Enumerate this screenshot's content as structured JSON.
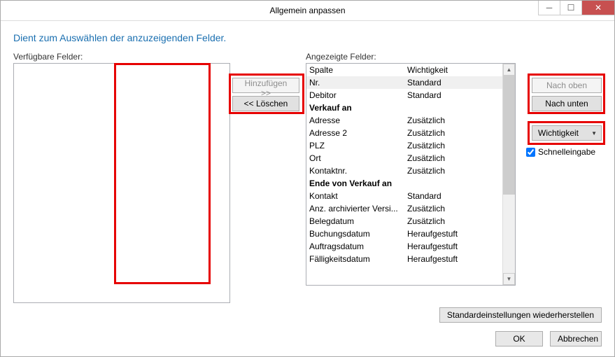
{
  "window": {
    "title": "Allgemein anpassen"
  },
  "description": "Dient zum Auswählen der anzuzeigenden Felder.",
  "lists": {
    "available_label": "Verfügbare Felder:",
    "displayed_label": "Angezeigte Felder:"
  },
  "importance_header": "Wichtigkeit",
  "displayed": [
    {
      "name": "Spalte",
      "importance": "Wichtigkeit",
      "bold": false,
      "selected": false
    },
    {
      "name": "Nr.",
      "importance": "Standard",
      "bold": false,
      "selected": true
    },
    {
      "name": "Debitor",
      "importance": "Standard",
      "bold": false,
      "selected": false
    },
    {
      "name": "Verkauf an",
      "importance": "",
      "bold": true,
      "selected": false
    },
    {
      "name": "Adresse",
      "importance": "Zusätzlich",
      "bold": false,
      "selected": false
    },
    {
      "name": "Adresse 2",
      "importance": "Zusätzlich",
      "bold": false,
      "selected": false
    },
    {
      "name": "PLZ",
      "importance": "Zusätzlich",
      "bold": false,
      "selected": false
    },
    {
      "name": "Ort",
      "importance": "Zusätzlich",
      "bold": false,
      "selected": false
    },
    {
      "name": "Kontaktnr.",
      "importance": "Zusätzlich",
      "bold": false,
      "selected": false
    },
    {
      "name": "Ende von Verkauf an",
      "importance": "",
      "bold": true,
      "selected": false
    },
    {
      "name": "Kontakt",
      "importance": "Standard",
      "bold": false,
      "selected": false
    },
    {
      "name": "Anz. archivierter Versi...",
      "importance": "Zusätzlich",
      "bold": false,
      "selected": false
    },
    {
      "name": "Belegdatum",
      "importance": "Zusätzlich",
      "bold": false,
      "selected": false
    },
    {
      "name": "Buchungsdatum",
      "importance": "Heraufgestuft",
      "bold": false,
      "selected": false
    },
    {
      "name": "Auftragsdatum",
      "importance": "Heraufgestuft",
      "bold": false,
      "selected": false
    },
    {
      "name": "Fälligkeitsdatum",
      "importance": "Heraufgestuft",
      "bold": false,
      "selected": false
    }
  ],
  "buttons": {
    "add": "Hinzufügen >>",
    "remove": "<< Löschen",
    "move_up": "Nach oben",
    "move_down": "Nach unten",
    "importance_select": "Wichtigkeit",
    "restore_defaults": "Standardeinstellungen wiederherstellen",
    "ok": "OK",
    "cancel": "Abbrechen"
  },
  "quick_entry": {
    "label": "Schnelleingabe",
    "checked": true
  }
}
